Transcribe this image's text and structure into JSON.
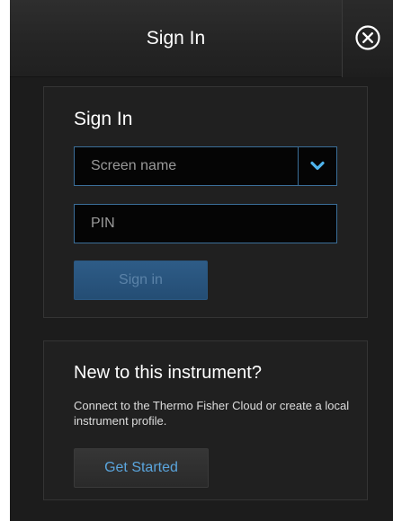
{
  "header": {
    "title": "Sign In",
    "close_icon": "close-circle-icon"
  },
  "signin_panel": {
    "heading": "Sign In",
    "screen_name_select": {
      "value": "Screen name",
      "icon": "chevron-down-icon"
    },
    "pin_field": {
      "placeholder": "PIN",
      "value": ""
    },
    "signin_button_label": "Sign in"
  },
  "new_panel": {
    "heading": "New to this instrument?",
    "description": "Connect to the Thermo Fisher Cloud or create a local instrument profile.",
    "get_started_label": "Get Started"
  },
  "colors": {
    "background": "#1c1c1c",
    "accent_blue": "#3b6f99",
    "link_blue": "#5aa5dd",
    "chevron_blue": "#4fb4ec"
  }
}
